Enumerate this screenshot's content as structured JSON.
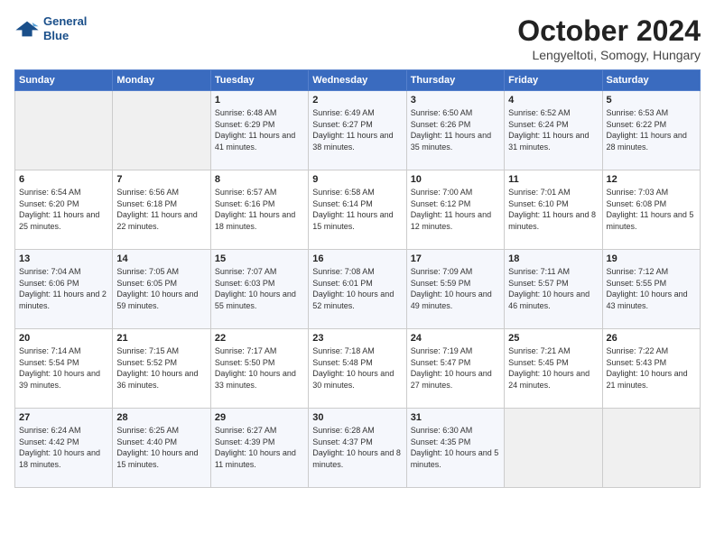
{
  "logo": {
    "line1": "General",
    "line2": "Blue"
  },
  "title": "October 2024",
  "location": "Lengyeltoti, Somogy, Hungary",
  "days_header": [
    "Sunday",
    "Monday",
    "Tuesday",
    "Wednesday",
    "Thursday",
    "Friday",
    "Saturday"
  ],
  "weeks": [
    [
      {
        "num": "",
        "info": ""
      },
      {
        "num": "",
        "info": ""
      },
      {
        "num": "1",
        "info": "Sunrise: 6:48 AM\nSunset: 6:29 PM\nDaylight: 11 hours and 41 minutes."
      },
      {
        "num": "2",
        "info": "Sunrise: 6:49 AM\nSunset: 6:27 PM\nDaylight: 11 hours and 38 minutes."
      },
      {
        "num": "3",
        "info": "Sunrise: 6:50 AM\nSunset: 6:26 PM\nDaylight: 11 hours and 35 minutes."
      },
      {
        "num": "4",
        "info": "Sunrise: 6:52 AM\nSunset: 6:24 PM\nDaylight: 11 hours and 31 minutes."
      },
      {
        "num": "5",
        "info": "Sunrise: 6:53 AM\nSunset: 6:22 PM\nDaylight: 11 hours and 28 minutes."
      }
    ],
    [
      {
        "num": "6",
        "info": "Sunrise: 6:54 AM\nSunset: 6:20 PM\nDaylight: 11 hours and 25 minutes."
      },
      {
        "num": "7",
        "info": "Sunrise: 6:56 AM\nSunset: 6:18 PM\nDaylight: 11 hours and 22 minutes."
      },
      {
        "num": "8",
        "info": "Sunrise: 6:57 AM\nSunset: 6:16 PM\nDaylight: 11 hours and 18 minutes."
      },
      {
        "num": "9",
        "info": "Sunrise: 6:58 AM\nSunset: 6:14 PM\nDaylight: 11 hours and 15 minutes."
      },
      {
        "num": "10",
        "info": "Sunrise: 7:00 AM\nSunset: 6:12 PM\nDaylight: 11 hours and 12 minutes."
      },
      {
        "num": "11",
        "info": "Sunrise: 7:01 AM\nSunset: 6:10 PM\nDaylight: 11 hours and 8 minutes."
      },
      {
        "num": "12",
        "info": "Sunrise: 7:03 AM\nSunset: 6:08 PM\nDaylight: 11 hours and 5 minutes."
      }
    ],
    [
      {
        "num": "13",
        "info": "Sunrise: 7:04 AM\nSunset: 6:06 PM\nDaylight: 11 hours and 2 minutes."
      },
      {
        "num": "14",
        "info": "Sunrise: 7:05 AM\nSunset: 6:05 PM\nDaylight: 10 hours and 59 minutes."
      },
      {
        "num": "15",
        "info": "Sunrise: 7:07 AM\nSunset: 6:03 PM\nDaylight: 10 hours and 55 minutes."
      },
      {
        "num": "16",
        "info": "Sunrise: 7:08 AM\nSunset: 6:01 PM\nDaylight: 10 hours and 52 minutes."
      },
      {
        "num": "17",
        "info": "Sunrise: 7:09 AM\nSunset: 5:59 PM\nDaylight: 10 hours and 49 minutes."
      },
      {
        "num": "18",
        "info": "Sunrise: 7:11 AM\nSunset: 5:57 PM\nDaylight: 10 hours and 46 minutes."
      },
      {
        "num": "19",
        "info": "Sunrise: 7:12 AM\nSunset: 5:55 PM\nDaylight: 10 hours and 43 minutes."
      }
    ],
    [
      {
        "num": "20",
        "info": "Sunrise: 7:14 AM\nSunset: 5:54 PM\nDaylight: 10 hours and 39 minutes."
      },
      {
        "num": "21",
        "info": "Sunrise: 7:15 AM\nSunset: 5:52 PM\nDaylight: 10 hours and 36 minutes."
      },
      {
        "num": "22",
        "info": "Sunrise: 7:17 AM\nSunset: 5:50 PM\nDaylight: 10 hours and 33 minutes."
      },
      {
        "num": "23",
        "info": "Sunrise: 7:18 AM\nSunset: 5:48 PM\nDaylight: 10 hours and 30 minutes."
      },
      {
        "num": "24",
        "info": "Sunrise: 7:19 AM\nSunset: 5:47 PM\nDaylight: 10 hours and 27 minutes."
      },
      {
        "num": "25",
        "info": "Sunrise: 7:21 AM\nSunset: 5:45 PM\nDaylight: 10 hours and 24 minutes."
      },
      {
        "num": "26",
        "info": "Sunrise: 7:22 AM\nSunset: 5:43 PM\nDaylight: 10 hours and 21 minutes."
      }
    ],
    [
      {
        "num": "27",
        "info": "Sunrise: 6:24 AM\nSunset: 4:42 PM\nDaylight: 10 hours and 18 minutes."
      },
      {
        "num": "28",
        "info": "Sunrise: 6:25 AM\nSunset: 4:40 PM\nDaylight: 10 hours and 15 minutes."
      },
      {
        "num": "29",
        "info": "Sunrise: 6:27 AM\nSunset: 4:39 PM\nDaylight: 10 hours and 11 minutes."
      },
      {
        "num": "30",
        "info": "Sunrise: 6:28 AM\nSunset: 4:37 PM\nDaylight: 10 hours and 8 minutes."
      },
      {
        "num": "31",
        "info": "Sunrise: 6:30 AM\nSunset: 4:35 PM\nDaylight: 10 hours and 5 minutes."
      },
      {
        "num": "",
        "info": ""
      },
      {
        "num": "",
        "info": ""
      }
    ]
  ]
}
